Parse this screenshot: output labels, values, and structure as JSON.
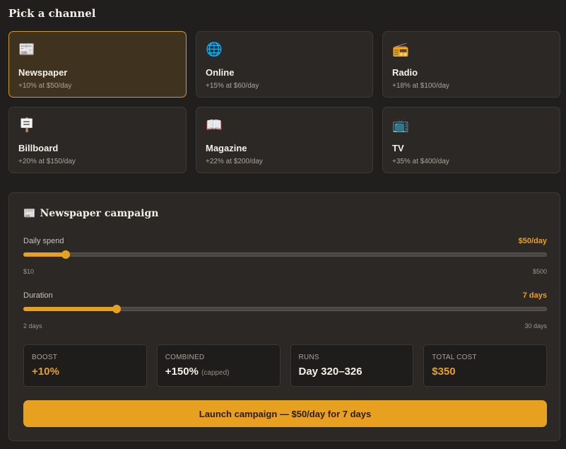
{
  "heading": "Pick a channel",
  "channels": [
    {
      "icon": "📰",
      "icon_name": "newspaper-icon",
      "name": "Newspaper",
      "detail": "+10% at $50/day",
      "selected": true
    },
    {
      "icon": "🌐",
      "icon_name": "globe-icon",
      "name": "Online",
      "detail": "+15% at $60/day",
      "selected": false
    },
    {
      "icon": "📻",
      "icon_name": "radio-icon",
      "name": "Radio",
      "detail": "+18% at $100/day",
      "selected": false
    },
    {
      "icon": "🪧",
      "icon_name": "billboard-icon",
      "name": "Billboard",
      "detail": "+20% at $150/day",
      "selected": false
    },
    {
      "icon": "📖",
      "icon_name": "book-icon",
      "name": "Magazine",
      "detail": "+22% at $200/day",
      "selected": false
    },
    {
      "icon": "📺",
      "icon_name": "tv-icon",
      "name": "TV",
      "detail": "+35% at $400/day",
      "selected": false
    }
  ],
  "campaign": {
    "icon": "📰",
    "title": "Newspaper campaign",
    "daily_spend": {
      "label": "Daily spend",
      "value_text": "$50/day",
      "min_label": "$10",
      "max_label": "$500",
      "min": 10,
      "max": 500,
      "value": 50
    },
    "duration": {
      "label": "Duration",
      "value_text": "7 days",
      "min_label": "2 days",
      "max_label": "30 days",
      "min": 2,
      "max": 30,
      "value": 7
    },
    "stats": {
      "boost": {
        "label": "BOOST",
        "value": "+10%"
      },
      "combined": {
        "label": "COMBINED",
        "value": "+150%",
        "note": "(capped)"
      },
      "runs": {
        "label": "RUNS",
        "value": "Day 320–326"
      },
      "total_cost": {
        "label": "TOTAL COST",
        "value": "$350"
      }
    },
    "launch_label": "Launch campaign — $50/day for 7 days"
  },
  "colors": {
    "accent": "#e8a020",
    "background": "#211f1d",
    "card": "#2b2826",
    "selected_card": "#3f331f"
  }
}
